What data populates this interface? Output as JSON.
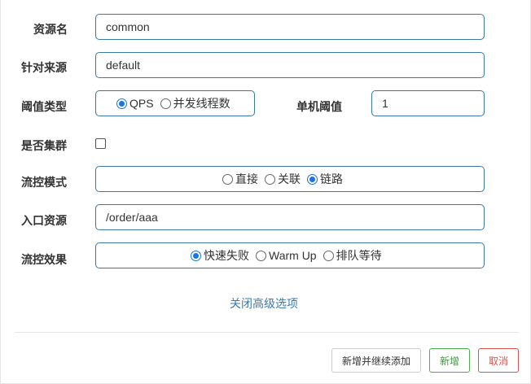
{
  "form": {
    "resource_name": {
      "label": "资源名",
      "value": "common"
    },
    "limit_app": {
      "label": "针对来源",
      "value": "default"
    },
    "grade": {
      "label": "阈值类型",
      "options": [
        {
          "label": "QPS",
          "checked": true
        },
        {
          "label": "并发线程数",
          "checked": false
        }
      ]
    },
    "threshold": {
      "label": "单机阈值",
      "value": "1"
    },
    "cluster": {
      "label": "是否集群",
      "checked": false
    },
    "strategy": {
      "label": "流控模式",
      "options": [
        {
          "label": "直接",
          "checked": false
        },
        {
          "label": "关联",
          "checked": false
        },
        {
          "label": "链路",
          "checked": true
        }
      ]
    },
    "ref_resource": {
      "label": "入口资源",
      "value": "/order/aaa"
    },
    "control_behavior": {
      "label": "流控效果",
      "options": [
        {
          "label": "快速失败",
          "checked": true
        },
        {
          "label": "Warm Up",
          "checked": false
        },
        {
          "label": "排队等待",
          "checked": false
        }
      ]
    },
    "advanced_toggle": "关闭高级选项"
  },
  "footer": {
    "add_continue_label": "新增并继续添加",
    "add_label": "新增",
    "cancel_label": "取消"
  },
  "colors": {
    "input_border": "#3a78a8",
    "link": "#3a7ab3",
    "success": "#4cae4c",
    "danger": "#d9534f",
    "radio_checked": "#1a73e8"
  }
}
